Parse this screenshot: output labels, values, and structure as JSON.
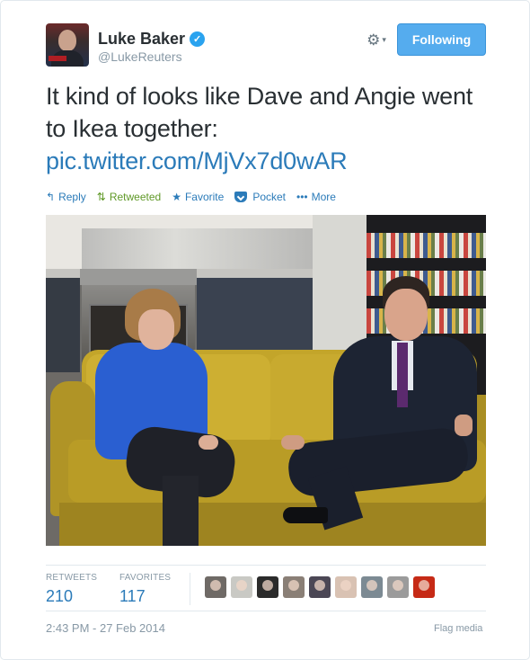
{
  "user": {
    "full_name": "Luke Baker",
    "screen_name": "@LukeReuters",
    "verified": true,
    "avatar_icon": "user-avatar-photo",
    "verified_icon": "verified-badge-icon"
  },
  "header": {
    "gear_icon": "gear-icon",
    "gear_glyph": "⚙",
    "caret_glyph": "▾",
    "follow_label": "Following"
  },
  "tweet": {
    "text": "It kind of looks like Dave and Angie went to Ikea together:",
    "link": "pic.twitter.com/MjVx7d0wAR"
  },
  "actions": [
    {
      "label": "Reply",
      "icon": "reply-icon",
      "glyph": "↰"
    },
    {
      "label": "Retweeted",
      "icon": "retweet-icon",
      "glyph": "⇅"
    },
    {
      "label": "Favorite",
      "icon": "star-icon",
      "glyph": "★"
    },
    {
      "label": "Pocket",
      "icon": "pocket-icon",
      "glyph": ""
    },
    {
      "label": "More",
      "icon": "more-icon",
      "glyph": "•••"
    }
  ],
  "media": {
    "type": "photo",
    "icon": "tweet-photo"
  },
  "stats": {
    "retweets_label": "RETWEETS",
    "retweets_count": "210",
    "favorites_label": "FAVORITES",
    "favorites_count": "117"
  },
  "favoriters": [
    {
      "name": "faver-avatar-1",
      "color": "#6f6a66"
    },
    {
      "name": "faver-avatar-2",
      "color": "#c9c9c4"
    },
    {
      "name": "faver-avatar-3",
      "color": "#2b2b2b"
    },
    {
      "name": "faver-avatar-4",
      "color": "#8a7f76"
    },
    {
      "name": "faver-avatar-5",
      "color": "#4b4755"
    },
    {
      "name": "faver-avatar-6",
      "color": "#d9c2b3"
    },
    {
      "name": "faver-avatar-7",
      "color": "#7c8a93"
    },
    {
      "name": "faver-avatar-8",
      "color": "#9b9b9b"
    },
    {
      "name": "faver-avatar-9",
      "color": "#c62a16"
    }
  ],
  "footer": {
    "timestamp": "2:43 PM - 27 Feb 2014",
    "flag_label": "Flag media"
  },
  "colors": {
    "link": "#2b7bb9",
    "follow_button": "#55acee",
    "retweeted_green": "#609928",
    "muted": "#8899a6"
  }
}
